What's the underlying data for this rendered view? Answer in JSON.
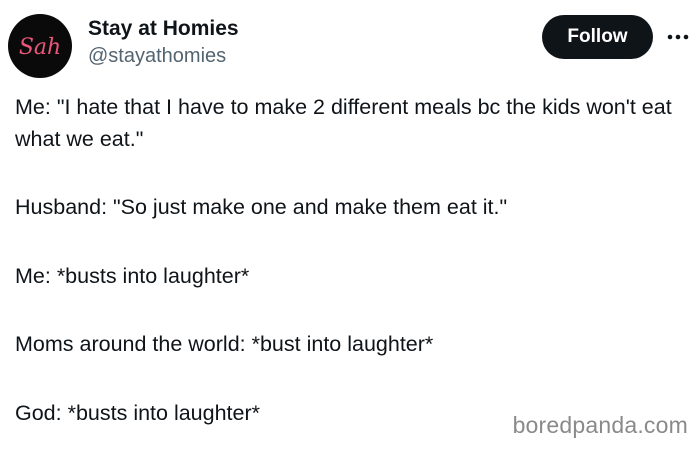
{
  "account": {
    "avatar_text": "Sah",
    "name": "Stay at Homies",
    "handle": "@stayathomies"
  },
  "actions": {
    "follow_label": "Follow",
    "more_icon": "more-horizontal-icon"
  },
  "tweet": {
    "paragraphs": [
      "Me: \"I hate that I have to make 2 different meals bc the kids won't eat what we eat.\"",
      "Husband: \"So just make one and make them eat it.\"",
      "Me: *busts into laughter*",
      "Moms around the world: *bust into laughter*",
      "God: *busts into laughter*"
    ]
  },
  "watermark": "boredpanda.com",
  "colors": {
    "text": "#0f1419",
    "secondary": "#536471",
    "follow_bg": "#0f1419",
    "avatar_bg": "#0a0a0a",
    "avatar_script": "#e8567a"
  }
}
